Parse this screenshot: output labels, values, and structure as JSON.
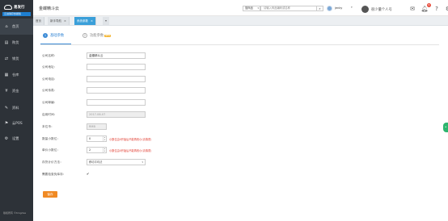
{
  "brand": {
    "title": "易发行",
    "bar_text": "云进销存旗舰版"
  },
  "sidebar": {
    "items": [
      {
        "label": "首页",
        "icon": "home-icon",
        "glyph": "⌂"
      },
      {
        "label": "购货",
        "icon": "cart-icon",
        "glyph": "🛒"
      },
      {
        "label": "销货",
        "icon": "sales-icon",
        "glyph": "⇄"
      },
      {
        "label": "仓库",
        "icon": "warehouse-icon",
        "glyph": "▦"
      },
      {
        "label": "资金",
        "icon": "money-icon",
        "glyph": "¥"
      },
      {
        "label": "资料",
        "icon": "pen-icon",
        "glyph": "✎"
      },
      {
        "label": "云POS",
        "icon": "pos-icon",
        "glyph": "⚑"
      },
      {
        "label": "设置",
        "icon": "gear-icon",
        "glyph": "⚙"
      }
    ],
    "footer": "版权所有 ©Kingdee"
  },
  "topbar": {
    "title": "金蝶精斗云",
    "search_scope": "搜商品",
    "search_placeholder": "请输入商品编码或名称",
    "user": "jenky",
    "profile_name": "很少量个人号",
    "notif_count": "6"
  },
  "page_tabs": [
    {
      "label": "首页",
      "active": false
    },
    {
      "label": "新手导航",
      "active": false,
      "close": "×"
    },
    {
      "label": "系统参数",
      "active": true,
      "close": "×"
    }
  ],
  "content_tabs": [
    {
      "num": "1",
      "label": "基础参数",
      "active": true
    },
    {
      "num": "2",
      "label": "功能参数",
      "active": false,
      "badge": "NEW"
    }
  ],
  "form": {
    "company_name": {
      "label": "公司名称：",
      "value": "金蝶精斗云"
    },
    "company_addr": {
      "label": "公司地址：",
      "value": ""
    },
    "company_phone": {
      "label": "公司电话：",
      "value": ""
    },
    "company_fax": {
      "label": "公司传真：",
      "value": ""
    },
    "company_zip": {
      "label": "公司邮编：",
      "value": ""
    },
    "enable_date": {
      "label": "启用时间：",
      "value": "2017-06-07"
    },
    "currency": {
      "label": "本位币：",
      "value": "RMB"
    },
    "qty_decimals": {
      "label": "数量小数位：",
      "value": "0",
      "warn": "小数位由0开始后不能再改小(请慎重)"
    },
    "price_decimals": {
      "label": "单价小数位：",
      "value": "2",
      "warn": "小数位由0开始后不能再改小(请慎重)"
    },
    "cost_method": {
      "label": "存货计价方法：",
      "value": "移动平均法"
    },
    "check_negative": {
      "label": "需要检查负库存：",
      "value": "✔"
    },
    "save_label": "保存"
  }
}
